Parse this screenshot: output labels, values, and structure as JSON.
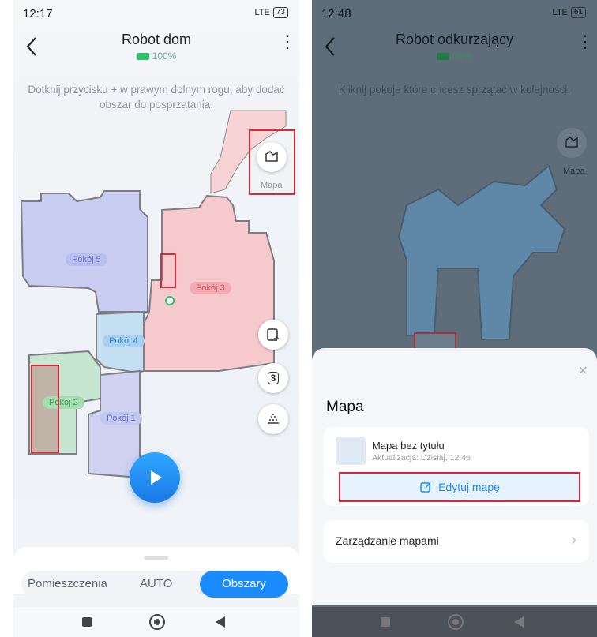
{
  "left": {
    "status": {
      "time": "12:17",
      "battery": "73",
      "network": "LTE"
    },
    "title": "Robot dom",
    "battery_text": "100%",
    "hint": "Dotknij przycisku + w prawym dolnym rogu, aby dodać obszar do posprzątania.",
    "map_button_label": "Mapa",
    "rooms": [
      "Pokój 5",
      "Pokój 3",
      "Pokój 4",
      "Pokój 2",
      "Pokój 1"
    ],
    "modes": {
      "rooms": "Pomieszczenia",
      "auto": "AUTO",
      "areas": "Obszary"
    },
    "cycle_count": "3"
  },
  "right": {
    "status": {
      "time": "12:48",
      "battery": "61",
      "network": "LTE"
    },
    "title": "Robot odkurzający",
    "battery_text": "96%",
    "hint": "Kliknij pokoje które chcesz sprzątać w kolejności.",
    "map_button_label": "Mapa",
    "sheet": {
      "title": "Mapa",
      "map_name": "Mapa bez tytułu",
      "updated": "Aktualizacja: Dzisiaj, 12:46",
      "edit_label": "Edytuj mapę",
      "manage_label": "Zarządzanie mapami"
    }
  },
  "colors": {
    "accent": "#1a8cff",
    "highlight": "#d62a3b",
    "room5": "#c9cdf2",
    "room3": "#f6c9cd",
    "room4": "#c4def2",
    "room2": "#c7e6cf",
    "room1": "#cfd1f0",
    "battery": "#2ec36a"
  }
}
